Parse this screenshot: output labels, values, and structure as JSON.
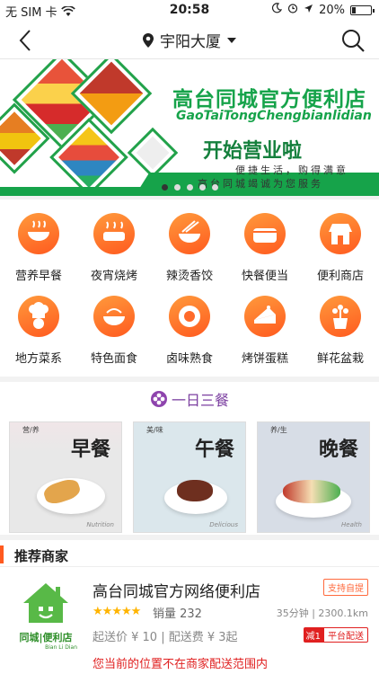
{
  "status_bar": {
    "carrier": "无 SIM 卡",
    "time": "20:58",
    "battery": "20%",
    "battery_level": 0.2,
    "icons": [
      "wifi-icon",
      "moon-icon",
      "alarm-icon",
      "location-arrow-icon",
      "battery-icon"
    ]
  },
  "nav": {
    "location": "宇阳大厦",
    "icons": [
      "back-icon",
      "location-pin-icon",
      "dropdown-icon",
      "search-icon"
    ]
  },
  "banner": {
    "title": "高台同城官方便利店",
    "subtitle": "GaoTaiTongChengbianlidian",
    "open_text": "开始营业啦",
    "slogan1": "便捷生活，购得满意",
    "slogan2": "高台同城竭诚为您服务",
    "slide_count": 5,
    "active_slide": 1
  },
  "categories": [
    {
      "label": "营养早餐",
      "icon": "bowl-icon"
    },
    {
      "label": "夜宵烧烤",
      "icon": "grill-icon"
    },
    {
      "label": "辣烫香饺",
      "icon": "noodles-icon"
    },
    {
      "label": "快餐便当",
      "icon": "bento-icon"
    },
    {
      "label": "便利商店",
      "icon": "store-icon"
    },
    {
      "label": "地方菜系",
      "icon": "chef-icon"
    },
    {
      "label": "特色面食",
      "icon": "noodle-bowl-icon"
    },
    {
      "label": "卤味熟食",
      "icon": "deli-icon"
    },
    {
      "label": "烤饼蛋糕",
      "icon": "cake-icon"
    },
    {
      "label": "鲜花盆栽",
      "icon": "flower-pot-icon"
    }
  ],
  "meals": {
    "heading": "一日三餐",
    "cards": [
      {
        "title": "早餐",
        "tag": "营/养",
        "note": "Nutrition"
      },
      {
        "title": "午餐",
        "tag": "美/味",
        "note": "Delicious"
      },
      {
        "title": "晚餐",
        "tag": "养/生",
        "note": "Health"
      }
    ]
  },
  "merchants": {
    "heading": "推荐商家",
    "items": [
      {
        "name": "高台同城官方网络便利店",
        "logo_text": "同城|便利店",
        "logo_sub": "Bian Li Dian",
        "self_pickup": "支持自提",
        "rating": 5,
        "sales": "销量 232",
        "eta": "35分钟 | 2300.1km",
        "fees": "起送价 ¥ 10 | 配送费 ¥ 3起",
        "platform_badge_short": "减1",
        "platform_badge": "平台配送",
        "warning": "您当前的位置不在商家配送范围内"
      }
    ]
  }
}
